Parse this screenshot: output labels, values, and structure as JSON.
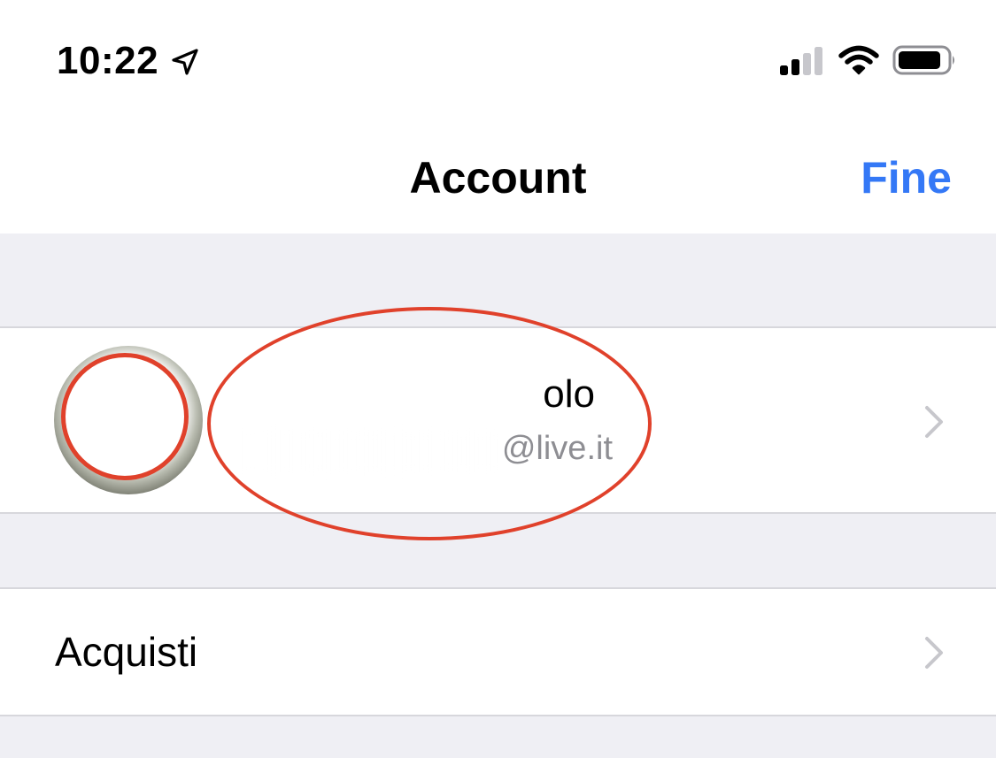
{
  "status_bar": {
    "time": "10:22",
    "icons": [
      "location-arrow-icon",
      "cellular-signal-icon",
      "wifi-icon",
      "battery-icon"
    ]
  },
  "nav": {
    "title": "Account",
    "done_label": "Fine"
  },
  "account": {
    "name_visible": "olo",
    "email_visible": "@live.it",
    "redacted": true
  },
  "list": {
    "purchases_label": "Acquisti"
  },
  "colors": {
    "accent": "#3478f6",
    "annotation": "#e0412b",
    "grouped_background": "#efeff4",
    "secondary_text": "#8e8e93"
  }
}
